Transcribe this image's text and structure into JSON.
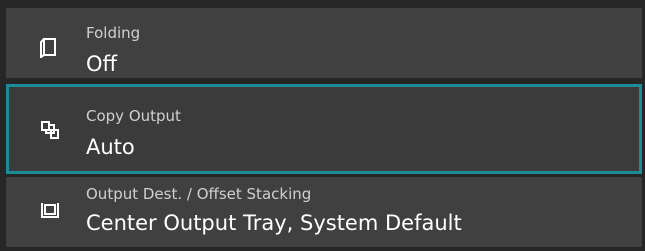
{
  "settings": [
    {
      "label": "Folding",
      "value": "Off",
      "icon": "folding-icon"
    },
    {
      "label": "Copy Output",
      "value": "Auto",
      "icon": "copy-output-icon",
      "selected": true
    },
    {
      "label": "Output Dest. / Offset Stacking",
      "value": "Center Output Tray, System Default",
      "icon": "output-tray-icon"
    }
  ],
  "colors": {
    "background": "#262626",
    "row": "#404040",
    "selection_border": "#1e8c96",
    "label_text": "#d0d0d0",
    "value_text": "#ffffff"
  }
}
